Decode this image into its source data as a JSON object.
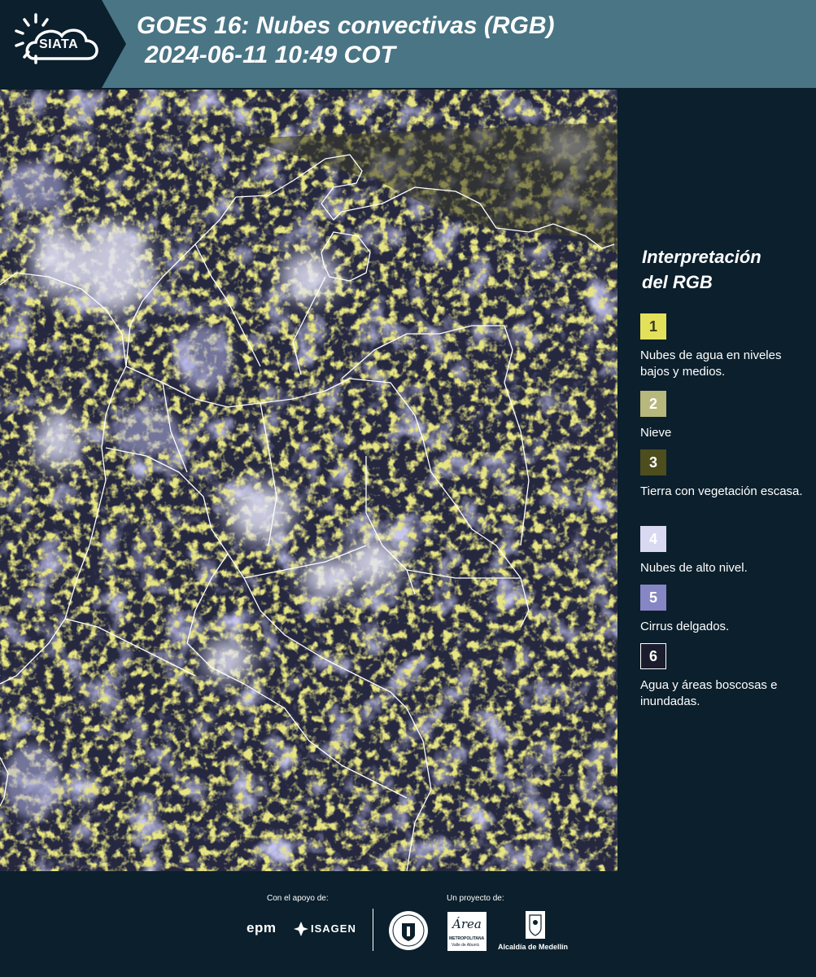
{
  "header": {
    "logo_text": "SIATA",
    "title_line1": "GOES 16: Nubes convectivas (RGB)",
    "title_line2": "2024-06-11 10:49 COT"
  },
  "legend": {
    "title_line1": "Interpretación",
    "title_line2": "del RGB",
    "items": [
      {
        "number": "1",
        "label": "Nubes de agua en niveles bajos y medios.",
        "color": "#e3e15a",
        "text_color": "#3a3a1a"
      },
      {
        "number": "2",
        "label": "Nieve",
        "color": "#b8b77c",
        "text_color": "#ffffff"
      },
      {
        "number": "3",
        "label": "Tierra con vegetación escasa.",
        "color": "#4d4d1e",
        "text_color": "#ffffff"
      },
      {
        "number": "4",
        "label": "Nubes de alto nivel.",
        "color": "#d9d9f2",
        "text_color": "#ffffff"
      },
      {
        "number": "5",
        "label": "Cirrus delgados.",
        "color": "#8686c4",
        "text_color": "#ffffff"
      },
      {
        "number": "6",
        "label": "Agua y áreas boscosas e inundadas.",
        "color": "#1b1d2e",
        "text_color": "#ffffff"
      }
    ]
  },
  "map": {
    "background": "#262840",
    "cloud_low_color": "#c8c640",
    "cloud_high_color": "#dcdcf4",
    "cirrus_color": "#7e7ec6",
    "border_color": "#ffffff"
  },
  "footer": {
    "support_label": "Con el apoyo de:",
    "project_label": "Un proyecto de:",
    "epm": "epm",
    "isagen": "ISAGEN",
    "area_text": "Área",
    "area_sub1": "METROPOLITANA",
    "area_sub2": "Valle de Aburrá",
    "alcaldia": "Alcaldía de Medellín"
  }
}
